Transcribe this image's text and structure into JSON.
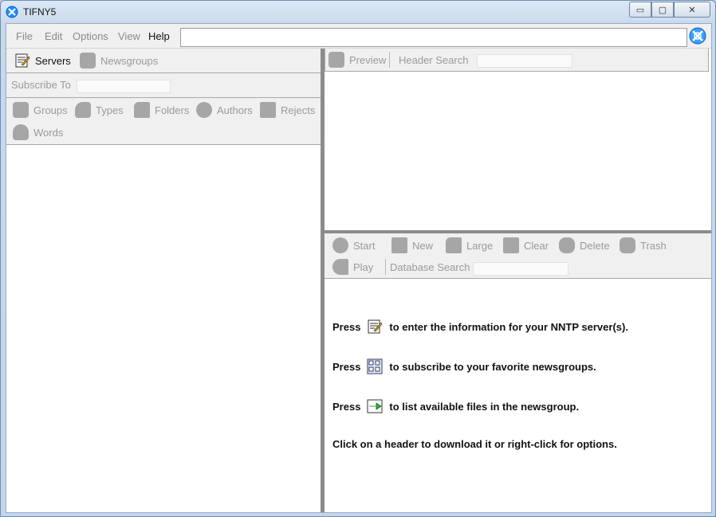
{
  "window": {
    "title": "TIFNY5",
    "minimize": "▭",
    "maximize": "▢",
    "close": "✕"
  },
  "menu": {
    "file": "File",
    "edit": "Edit",
    "options": "Options",
    "view": "View",
    "help": "Help"
  },
  "url": {
    "value": ""
  },
  "left": {
    "servers": "Servers",
    "newsgroups": "Newsgroups",
    "subscribe_to": "Subscribe To",
    "groups": "Groups",
    "types": "Types",
    "folders": "Folders",
    "authors": "Authors",
    "rejects": "Rejects",
    "words": "Words"
  },
  "right_top": {
    "preview": "Preview",
    "header_search": "Header Search"
  },
  "right_bottom": {
    "start": "Start",
    "new": "New",
    "large": "Large",
    "clear": "Clear",
    "delete": "Delete",
    "trash": "Trash",
    "play": "Play",
    "database_search": "Database Search"
  },
  "help": {
    "line1_pre": "Press",
    "line1_post": "to enter the information for your NNTP server(s).",
    "line2_pre": "Press",
    "line2_post": "to subscribe to your favorite newsgroups.",
    "line3_pre": "Press",
    "line3_post": "to list available files in the newsgroup.",
    "line4": "Click on a header to download it or right-click for options."
  },
  "colors": {
    "accent": "#1e90ff",
    "disabled_text": "#9a9a9a",
    "divider": "#8c8c8c"
  },
  "icons": [
    "globe-icon",
    "servers-icon",
    "newsgroups-icon",
    "groups-icon",
    "types-icon",
    "folders-icon",
    "authors-icon",
    "rejects-icon",
    "words-icon",
    "preview-icon",
    "start-icon",
    "new-icon",
    "large-icon",
    "clear-icon",
    "delete-icon",
    "trash-icon",
    "play-icon"
  ]
}
